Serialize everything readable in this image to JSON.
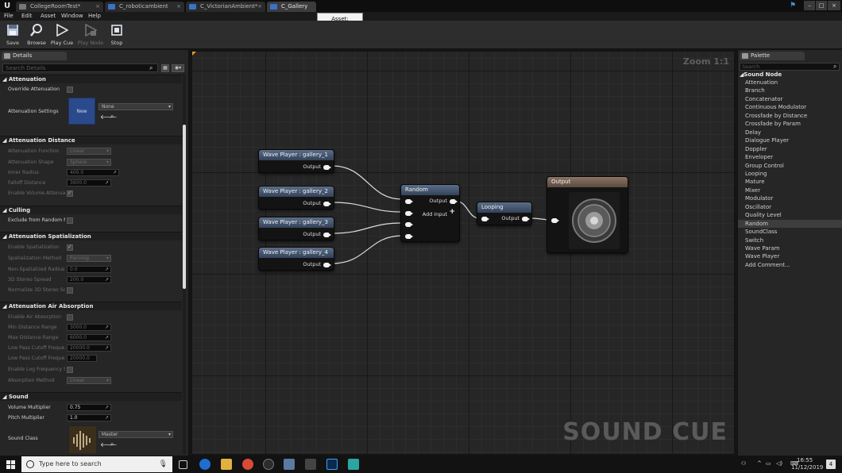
{
  "titlebar": {
    "tabs": [
      {
        "label": "CollegeRoomTest*",
        "active": false
      },
      {
        "label": "C_roboticambient",
        "active": false
      },
      {
        "label": "C_VictorianAmbient*",
        "active": false
      },
      {
        "label": "C_Gallery",
        "active": true
      }
    ],
    "close_glyph": "×",
    "window_controls": [
      "–",
      "□",
      "×"
    ]
  },
  "menu": [
    "File",
    "Edit",
    "Asset",
    "Window",
    "Help"
  ],
  "tooltip": "Asset: C_Gallery",
  "toolbar": {
    "save": "Save",
    "browse": "Browse",
    "play_cue": "Play Cue",
    "play_node": "Play Node",
    "stop": "Stop"
  },
  "details": {
    "tab_label": "Details",
    "search_placeholder": "Search Details",
    "sections": {
      "attenuation": "Attenuation",
      "attenuation_distance": "Attenuation Distance",
      "culling": "Culling",
      "attenuation_spatialization": "Attenuation Spatialization",
      "attenuation_air_absorption": "Attenuation Air Absorption",
      "sound": "Sound"
    },
    "override_attenuation": "Override Attenuation",
    "attenuation_settings": "Attenuation Settings",
    "attenuation_settings_value": "None",
    "new_thumb": "New",
    "attenuation_function": {
      "label": "Attenuation Function",
      "value": "Linear"
    },
    "attenuation_shape": {
      "label": "Attenuation Shape",
      "value": "Sphere"
    },
    "inner_radius": {
      "label": "Inner Radius",
      "value": "400.0"
    },
    "falloff_distance": {
      "label": "Falloff Distance",
      "value": "3600.0"
    },
    "enable_volume_attenuation": "Enable Volume Attenuati",
    "exclude_from_random": "Exclude from Random No",
    "enable_spatialization": "Enable Spatialization",
    "spatialization_method": {
      "label": "Spatialization Method",
      "value": "Panning"
    },
    "non_spatialized_radius": {
      "label": "Non-Spatialized Radius",
      "value": "0.0"
    },
    "stereo_spread": {
      "label": "3D Stereo Spread",
      "value": "200.0"
    },
    "normalize_stereo": "Normalize 3D Stereo Sou",
    "enable_air_absorption": "Enable Air Absorption",
    "min_distance_range": {
      "label": "Min Distance Range",
      "value": "3000.0"
    },
    "max_distance_range": {
      "label": "Max Distance Range",
      "value": "6000.0"
    },
    "low_pass_cutoff_1": {
      "label": "Low Pass Cutoff Frequenc",
      "value": "20000.0"
    },
    "low_pass_cutoff_2": {
      "label": "Low Pass Cutoff Frequenc",
      "value": "20000.0"
    },
    "enable_log_frequency": "Enable Log Frequency Sc",
    "absorption_method": {
      "label": "Absorption Method",
      "value": "Linear"
    },
    "volume_multiplier": {
      "label": "Volume Multiplier",
      "value": "0.75"
    },
    "pitch_multiplier": {
      "label": "Pitch Multiplier",
      "value": "1.0"
    },
    "sound_class": {
      "label": "Sound Class",
      "value": "Master"
    }
  },
  "graph": {
    "zoom": "Zoom 1:1",
    "watermark": "SOUND CUE",
    "nodes": {
      "wp1": {
        "title": "Wave Player : gallery_1",
        "output": "Output"
      },
      "wp2": {
        "title": "Wave Player : gallery_2",
        "output": "Output"
      },
      "wp3": {
        "title": "Wave Player : gallery_3",
        "output": "Output"
      },
      "wp4": {
        "title": "Wave Player : gallery_4",
        "output": "Output"
      },
      "random": {
        "title": "Random",
        "output": "Output",
        "add_input": "Add input"
      },
      "looping": {
        "title": "Looping",
        "output": "Output"
      },
      "output": {
        "title": "Output"
      }
    }
  },
  "palette": {
    "tab_label": "Palette",
    "search_placeholder": "Search",
    "category": "Sound Node",
    "items": [
      "Attenuation",
      "Branch",
      "Concatenator",
      "Continuous Modulator",
      "Crossfade by Distance",
      "Crossfade by Param",
      "Delay",
      "Dialogue Player",
      "Doppler",
      "Enveloper",
      "Group Control",
      "Looping",
      "Mature",
      "Mixer",
      "Modulator",
      "Oscillator",
      "Quality Level",
      "Random",
      "SoundClass",
      "Switch",
      "Wave Param",
      "Wave Player",
      "Add Comment..."
    ],
    "selected": "Random"
  },
  "taskbar": {
    "search_placeholder": "Type here to search",
    "time": "16:55",
    "date": "11/12/2019",
    "notification_count": "4"
  },
  "colors": {
    "node_header_blue": "#4a5a73",
    "node_header_output": "#7a6455",
    "graph_bg": "#262626"
  }
}
